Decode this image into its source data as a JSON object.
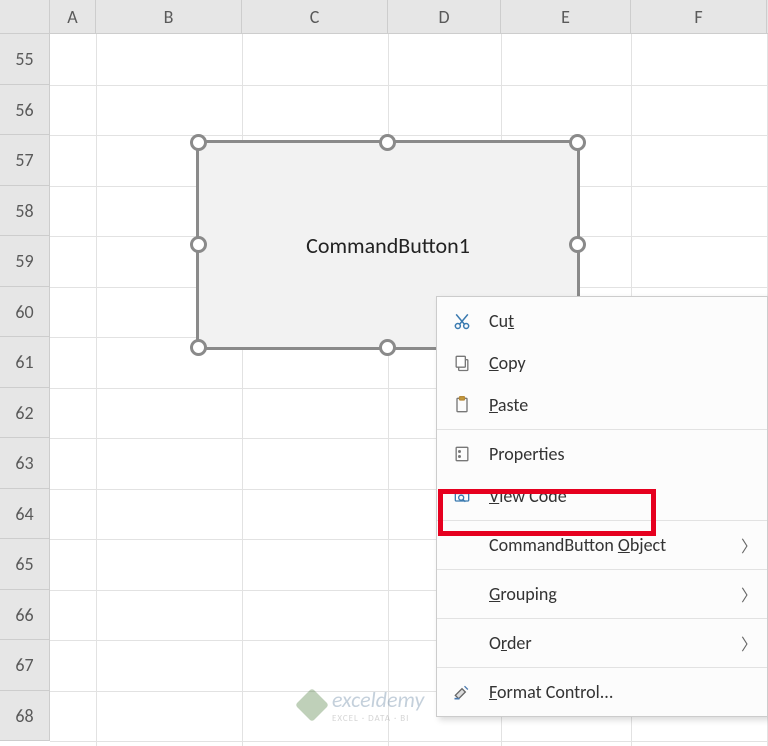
{
  "columns": [
    "A",
    "B",
    "C",
    "D",
    "E",
    "F"
  ],
  "rows": [
    "55",
    "56",
    "57",
    "58",
    "59",
    "60",
    "61",
    "62",
    "63",
    "64",
    "65",
    "66",
    "67",
    "68"
  ],
  "button": {
    "label": "CommandButton1"
  },
  "menu": {
    "cut": "Cut",
    "copy": "Copy",
    "paste": "Paste",
    "properties": "Properties",
    "viewcode": "View Code",
    "cbobject": "CommandButton Object",
    "grouping": "Grouping",
    "order": "Order",
    "format": "Format Control..."
  },
  "watermark": {
    "name": "exceldemy",
    "sub": "EXCEL · DATA · BI"
  }
}
